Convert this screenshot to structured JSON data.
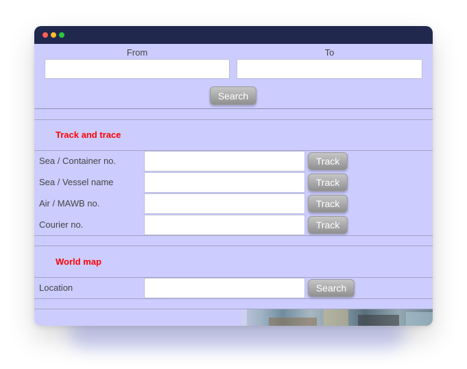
{
  "route": {
    "from_label": "From",
    "to_label": "To",
    "from_value": "",
    "to_value": "",
    "search_label": "Search"
  },
  "track_and_trace": {
    "title": "Track and trace",
    "rows": [
      {
        "label": "Sea / Container no.",
        "value": "",
        "button": "Track"
      },
      {
        "label": "Sea / Vessel name",
        "value": "",
        "button": "Track"
      },
      {
        "label": "Air / MAWB no.",
        "value": "",
        "button": "Track"
      },
      {
        "label": "Courier no.",
        "value": "",
        "button": "Track"
      }
    ]
  },
  "world_map": {
    "title": "World map",
    "location_label": "Location",
    "location_value": "",
    "search_label": "Search"
  },
  "colors": {
    "panel": "#ccccff",
    "titlebar": "#20284d",
    "section_title": "#ff0000"
  }
}
